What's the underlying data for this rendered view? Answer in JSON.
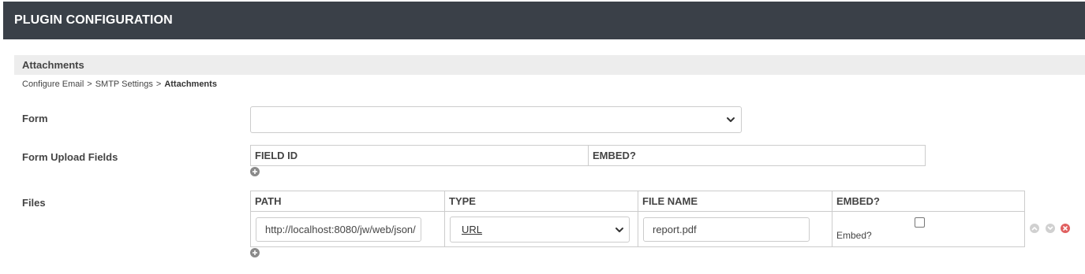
{
  "header": {
    "title": "PLUGIN CONFIGURATION"
  },
  "section": {
    "title": "Attachments"
  },
  "breadcrumb": {
    "items": [
      "Configure Email",
      "SMTP Settings"
    ],
    "separator": ">",
    "current": "Attachments"
  },
  "form_field": {
    "label": "Form",
    "value": ""
  },
  "upload_fields": {
    "label": "Form Upload Fields",
    "columns": [
      "FIELD ID",
      "EMBED?"
    ]
  },
  "files": {
    "label": "Files",
    "columns": [
      "PATH",
      "TYPE",
      "FILE NAME",
      "EMBED?"
    ],
    "rows": [
      {
        "path": "http://localhost:8080/jw/web/json/",
        "type": "URL",
        "file_name": "report.pdf",
        "embed_label": "Embed?",
        "embed_checked": false
      }
    ]
  },
  "icons": {
    "add": "add-circle-icon",
    "move_up": "move-up-icon",
    "move_down": "move-down-icon",
    "delete": "delete-icon"
  },
  "colors": {
    "header_bg": "#3a4048",
    "section_bg": "#ededed",
    "icon_gray": "#c4c4c4",
    "delete_red": "#e06060"
  }
}
